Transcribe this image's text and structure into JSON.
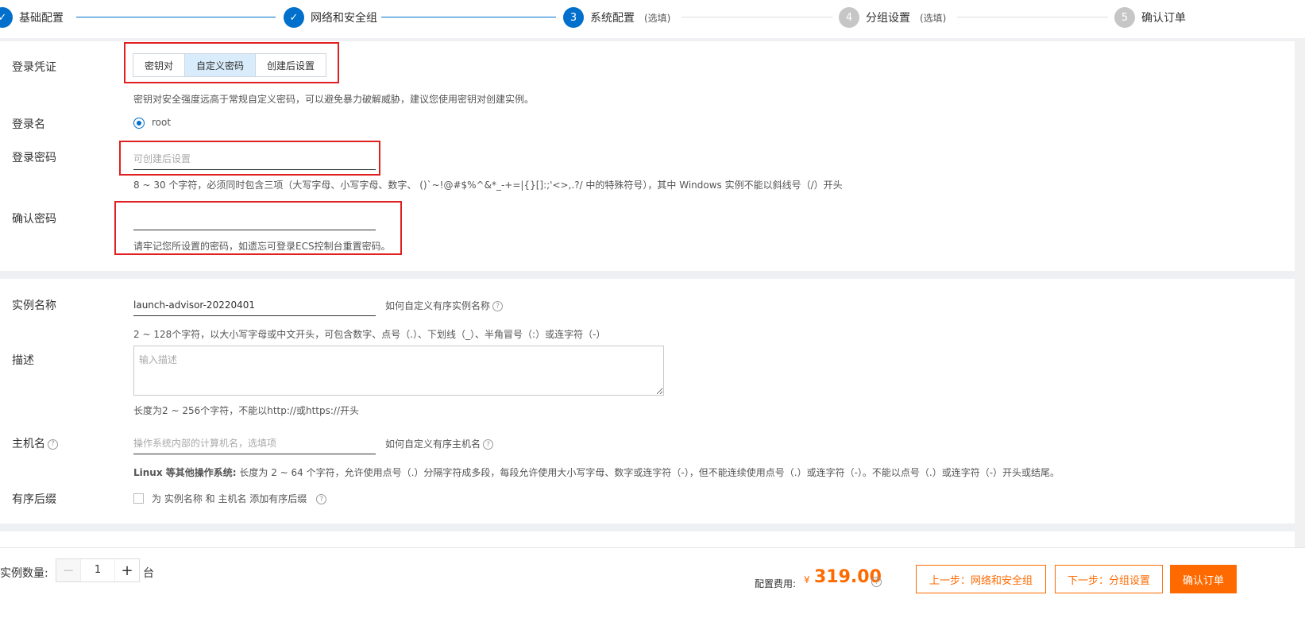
{
  "stepper": {
    "steps": [
      {
        "num": "✓",
        "label": "基础配置",
        "optional": ""
      },
      {
        "num": "✓",
        "label": "网络和安全组",
        "optional": ""
      },
      {
        "num": "3",
        "label": "系统配置",
        "optional": "(选填)"
      },
      {
        "num": "4",
        "label": "分组设置",
        "optional": "(选填)"
      },
      {
        "num": "5",
        "label": "确认订单",
        "optional": ""
      }
    ]
  },
  "login": {
    "credential_label": "登录凭证",
    "credential_options": [
      "密钥对",
      "自定义密码",
      "创建后设置"
    ],
    "credential_selected": "自定义密码",
    "credential_help": "密钥对安全强度远高于常规自定义密码，可以避免暴力破解威胁，建议您使用密钥对创建实例。",
    "username_label": "登录名",
    "username_value": "root",
    "password_label": "登录密码",
    "password_placeholder": "可创建后设置",
    "password_help": "8 ~ 30 个字符，必须同时包含三项（大写字母、小写字母、数字、 ()`~!@#$%^&*_-+=|{}[]:;'<>,.?/ 中的特殊符号），其中 Windows 实例不能以斜线号（/）开头",
    "confirm_label": "确认密码",
    "confirm_help": "请牢记您所设置的密码，如遗忘可登录ECS控制台重置密码。"
  },
  "instance": {
    "name_label": "实例名称",
    "name_value": "launch-advisor-20220401",
    "name_link": "如何自定义有序实例名称",
    "name_help": "2 ~ 128个字符，以大小写字母或中文开头，可包含数字、点号（.）、下划线（_）、半角冒号（:）或连字符（-）",
    "desc_label": "描述",
    "desc_placeholder": "输入描述",
    "desc_help": "长度为2 ~ 256个字符，不能以http://或https://开头",
    "hostname_label": "主机名",
    "hostname_placeholder": "操作系统内部的计算机名，选填项",
    "hostname_link": "如何自定义有序主机名",
    "hostname_help_bold": "Linux 等其他操作系统:",
    "hostname_help": " 长度为 2 ~ 64 个字符，允许使用点号（.）分隔字符成多段，每段允许使用大小写字母、数字或连字符（-），但不能连续使用点号（.）或连字符（-）。不能以点号（.）或连字符（-）开头或结尾。",
    "suffix_label": "有序后缀",
    "suffix_text": "为 实例名称 和 主机名 添加有序后缀"
  },
  "footer": {
    "qty_label": "实例数量:",
    "qty_value": "1",
    "qty_unit": "台",
    "fee_label": "配置费用:",
    "fee_currency": "¥",
    "fee_value": "319.00",
    "prev_button": "上一步：网络和安全组",
    "next_button": "下一步：分组设置",
    "confirm_button": "确认订单"
  },
  "colors": {
    "accent": "#0070cc",
    "orange": "#ff6a00",
    "highlight": "#e02020"
  }
}
